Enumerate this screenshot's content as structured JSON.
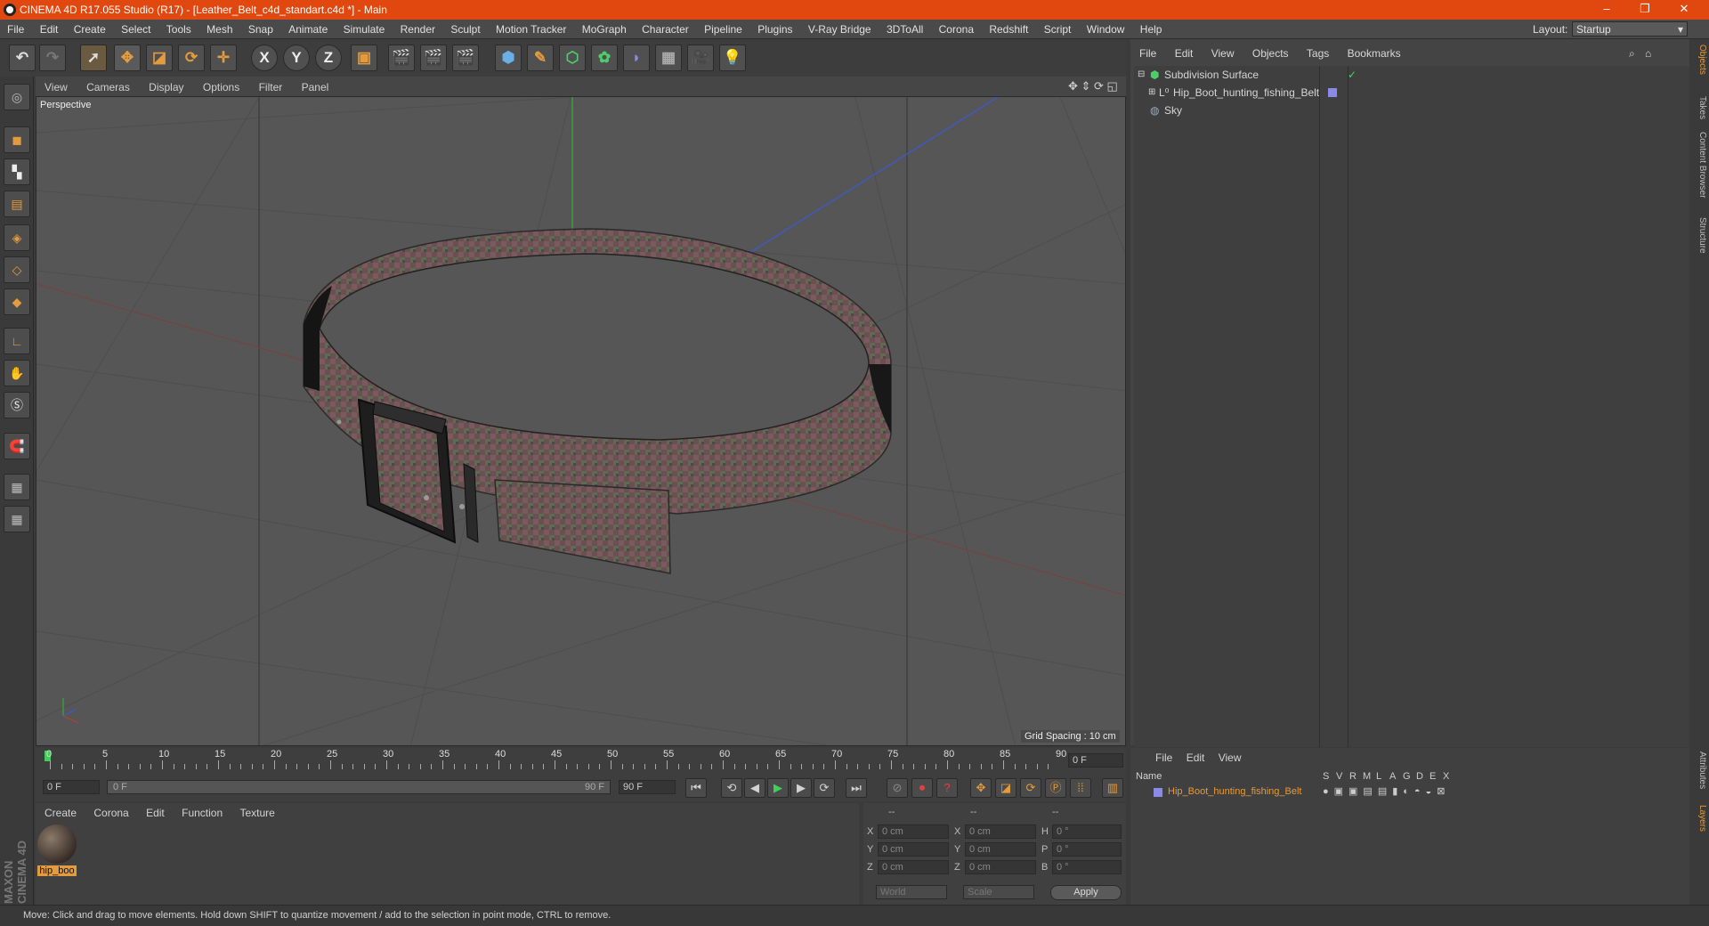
{
  "titlebar": {
    "title": "CINEMA 4D R17.055 Studio (R17) - [Leather_Belt_c4d_standart.c4d *] - Main",
    "minimize": "–",
    "restore": "❐",
    "close": "✕"
  },
  "menubar": {
    "items": [
      "File",
      "Edit",
      "Create",
      "Select",
      "Tools",
      "Mesh",
      "Snap",
      "Animate",
      "Simulate",
      "Render",
      "Sculpt",
      "Motion Tracker",
      "MoGraph",
      "Character",
      "Pipeline",
      "Plugins",
      "V-Ray Bridge",
      "3DToAll",
      "Corona",
      "Redshift",
      "Script",
      "Window",
      "Help"
    ],
    "layout_label": "Layout:",
    "layout_value": "Startup"
  },
  "toolbar": {
    "axis_x": "X",
    "axis_y": "Y",
    "axis_z": "Z"
  },
  "viewport": {
    "menu": [
      "View",
      "Cameras",
      "Display",
      "Options",
      "Filter",
      "Panel"
    ],
    "label": "Perspective",
    "grid_spacing": "Grid Spacing : 10 cm"
  },
  "object_manager": {
    "menu": [
      "File",
      "Edit",
      "View",
      "Objects",
      "Tags",
      "Bookmarks"
    ],
    "objects": [
      {
        "name": "Subdivision Surface"
      },
      {
        "name": "Hip_Boot_hunting_fishing_Belt"
      },
      {
        "name": "Sky"
      }
    ]
  },
  "side_tabs": [
    "Objects",
    "Takes",
    "Content Browser",
    "Structure",
    "Attributes",
    "Layers"
  ],
  "timeline": {
    "ticks": [
      "0",
      "5",
      "10",
      "15",
      "20",
      "25",
      "30",
      "35",
      "40",
      "45",
      "50",
      "55",
      "60",
      "65",
      "70",
      "75",
      "80",
      "85",
      "90"
    ],
    "current_frame": "0 F",
    "start_field": "0 F",
    "range_start": "0 F",
    "range_end": "90 F",
    "end_field": "90 F"
  },
  "material_manager": {
    "menu": [
      "Create",
      "Corona",
      "Edit",
      "Function",
      "Texture"
    ],
    "material_name": "hip_boo"
  },
  "coordinates": {
    "col_headers": [
      "--",
      "--",
      "--"
    ],
    "rows": [
      {
        "a": "X",
        "v1": "0 cm",
        "b": "X",
        "v2": "0 cm",
        "c": "H",
        "v3": "0 °"
      },
      {
        "a": "Y",
        "v1": "0 cm",
        "b": "Y",
        "v2": "0 cm",
        "c": "P",
        "v3": "0 °"
      },
      {
        "a": "Z",
        "v1": "0 cm",
        "b": "Z",
        "v2": "0 cm",
        "c": "B",
        "v3": "0 °"
      }
    ],
    "world": "World",
    "scale": "Scale",
    "apply": "Apply"
  },
  "layer_manager": {
    "menu": [
      "File",
      "Edit",
      "View"
    ],
    "name_header": "Name",
    "flags": [
      "S",
      "V",
      "R",
      "M",
      "L",
      "A",
      "G",
      "D",
      "E",
      "X"
    ],
    "layer_name": "Hip_Boot_hunting_fishing_Belt"
  },
  "logo": "MAXON CINEMA 4D",
  "status": "Move: Click and drag to move elements. Hold down SHIFT to quantize movement / add to the selection in point mode, CTRL to remove.",
  "colors": {
    "titlebar": "#e04810",
    "accent": "#e39b3c",
    "axis_x": "#c03a3a",
    "axis_y": "#3aa63a",
    "axis_z": "#3a5ad0"
  }
}
